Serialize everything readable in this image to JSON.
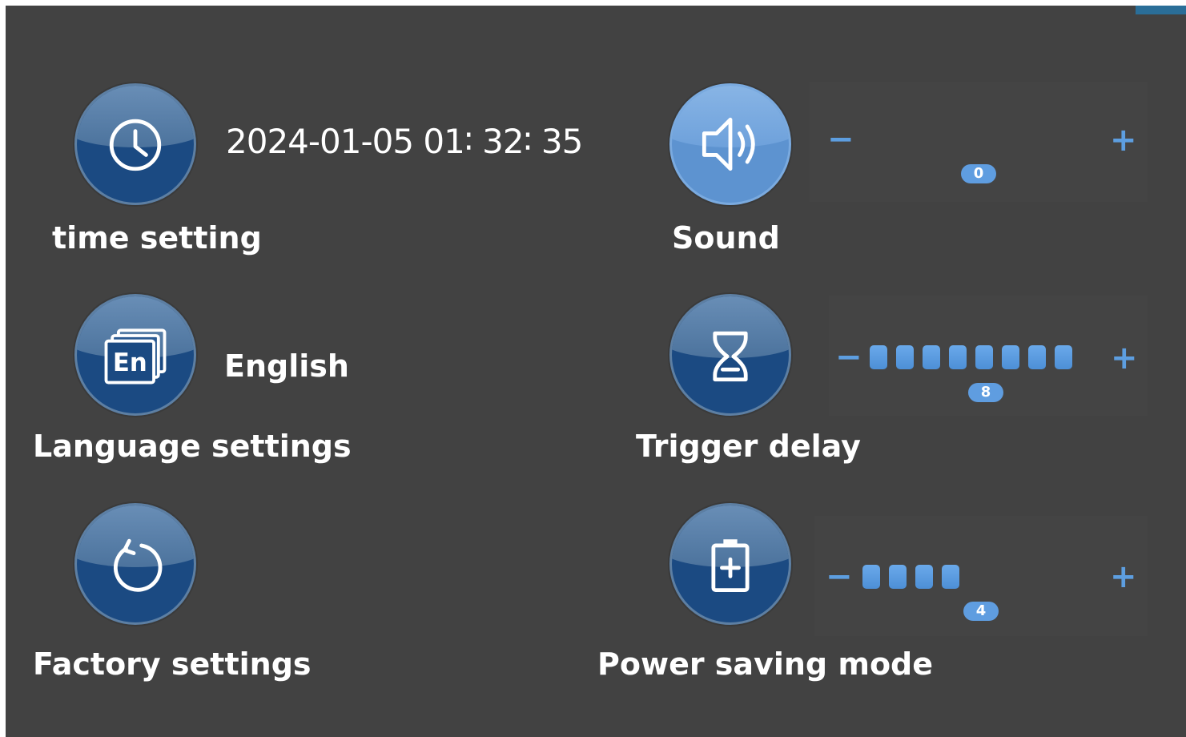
{
  "time_setting": {
    "label": "time setting",
    "datetime": "2024-01-05 01∶ 32∶ 35",
    "icon": "clock-icon"
  },
  "sound": {
    "label": "Sound",
    "icon": "speaker-icon",
    "value": "0",
    "max": 10,
    "minus": "−",
    "plus": "+"
  },
  "language": {
    "label": "Language settings",
    "current": "English",
    "icon": "language-en-icon",
    "icon_text": "En"
  },
  "trigger_delay": {
    "label": "Trigger delay",
    "icon": "hourglass-icon",
    "value": "8",
    "max": 10,
    "minus": "−",
    "plus": "+"
  },
  "factory": {
    "label": "Factory settings",
    "icon": "reset-icon"
  },
  "power_saving": {
    "label": "Power saving mode",
    "icon": "battery-plus-icon",
    "value": "4",
    "max": 10,
    "minus": "−",
    "plus": "+"
  },
  "colors": {
    "panel_bg": "#424242",
    "accent": "#5d9ee0",
    "icon_dark": "#1b4a82",
    "icon_light": "#5d93d0"
  }
}
